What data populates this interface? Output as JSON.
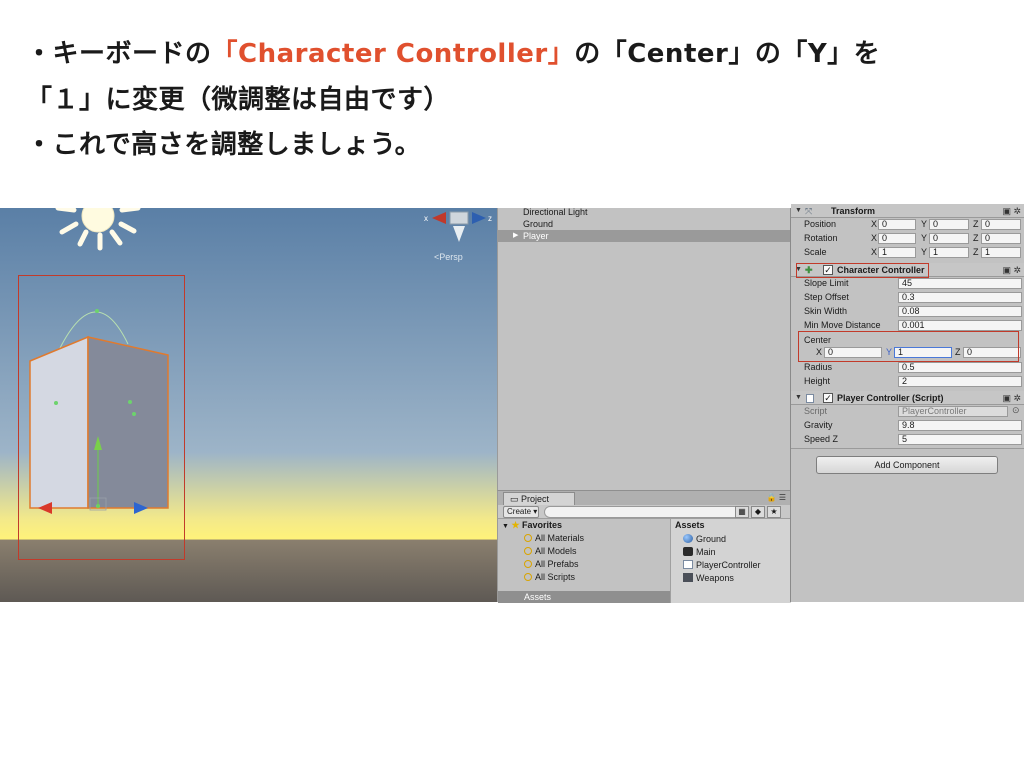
{
  "slide": {
    "line1_prefix": "・キーボードの",
    "line1_accent": "「Character Controller」",
    "line1_suffix": "の「Center」の「Y」を",
    "line2": "「１」に変更（微調整は自由です）",
    "line3": "・これで高さを調整しましょう。",
    "accent_color": "#e0502e"
  },
  "scene": {
    "persp_label": "<Persp",
    "gizmo_axes": {
      "x": "x",
      "z": "z"
    }
  },
  "hierarchy": {
    "items": [
      {
        "label": "Directional Light",
        "selected": false
      },
      {
        "label": "Ground",
        "selected": false
      },
      {
        "label": "Player",
        "selected": true,
        "expandable": true
      }
    ]
  },
  "project": {
    "tab_label": "Project",
    "create_label": "Create",
    "favorites_label": "Favorites",
    "favorites": [
      "All Materials",
      "All Models",
      "All Prefabs",
      "All Scripts"
    ],
    "assets_label": "Assets",
    "assets": [
      {
        "label": "Ground",
        "icon": "sphere-material-icon"
      },
      {
        "label": "Main",
        "icon": "unity-scene-icon"
      },
      {
        "label": "PlayerController",
        "icon": "script-icon"
      },
      {
        "label": "Weapons",
        "icon": "folder-icon"
      }
    ],
    "assets_root_label": "Assets"
  },
  "inspector": {
    "transform": {
      "title": "Transform",
      "rows": [
        {
          "label": "Position",
          "x": "0",
          "y": "0",
          "z": "0"
        },
        {
          "label": "Rotation",
          "x": "0",
          "y": "0",
          "z": "0"
        },
        {
          "label": "Scale",
          "x": "1",
          "y": "1",
          "z": "1"
        }
      ]
    },
    "character_controller": {
      "title": "Character Controller",
      "slope_limit_label": "Slope Limit",
      "slope_limit": "45",
      "step_offset_label": "Step Offset",
      "step_offset": "0.3",
      "skin_width_label": "Skin Width",
      "skin_width": "0.08",
      "min_move_label": "Min Move Distance",
      "min_move": "0.001",
      "center_label": "Center",
      "center_x": "0",
      "center_y": "1",
      "center_z": "0",
      "radius_label": "Radius",
      "radius": "0.5",
      "height_label": "Height",
      "height": "2"
    },
    "player_controller": {
      "title": "Player Controller (Script)",
      "script_label": "Script",
      "script_value": "PlayerController",
      "gravity_label": "Gravity",
      "gravity": "9.8",
      "speed_label": "Speed Z",
      "speed": "5"
    },
    "add_component_label": "Add Component",
    "axis_x": "X",
    "axis_y": "Y",
    "axis_z": "Z"
  }
}
